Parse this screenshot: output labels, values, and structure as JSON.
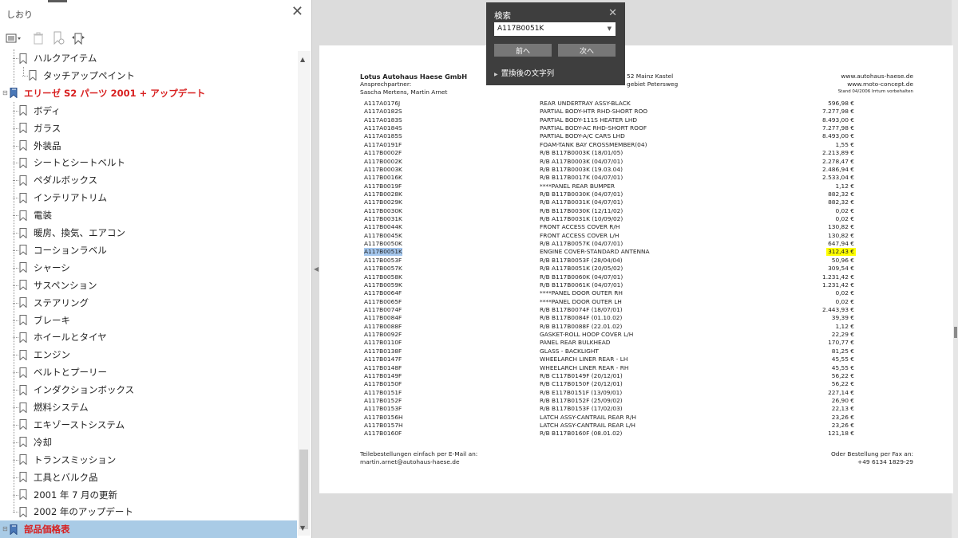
{
  "sidebar": {
    "title": "しおり",
    "toolbar": {
      "options_icon": "list-options-icon",
      "delete_icon": "trash-icon",
      "new_bookmark_icon": "new-bookmark-icon",
      "expand_icon": "expand-bookmark-icon"
    },
    "items": [
      {
        "label": "ハルクアイテム",
        "level": 1
      },
      {
        "label": "タッチアップペイント",
        "level": 2
      },
      {
        "label": "エリーゼ S2 パーツ 2001 + アップデート",
        "level": 0
      },
      {
        "label": "ボディ",
        "level": 1
      },
      {
        "label": "ガラス",
        "level": 1
      },
      {
        "label": "外装品",
        "level": 1
      },
      {
        "label": "シートとシートベルト",
        "level": 1
      },
      {
        "label": "ペダルボックス",
        "level": 1
      },
      {
        "label": "インテリアトリム",
        "level": 1
      },
      {
        "label": "電装",
        "level": 1
      },
      {
        "label": "暖房、換気、エアコン",
        "level": 1
      },
      {
        "label": "コーションラベル",
        "level": 1
      },
      {
        "label": "シャーシ",
        "level": 1
      },
      {
        "label": "サスペンション",
        "level": 1
      },
      {
        "label": "ステアリング",
        "level": 1
      },
      {
        "label": "ブレーキ",
        "level": 1
      },
      {
        "label": "ホイールとタイヤ",
        "level": 1
      },
      {
        "label": "エンジン",
        "level": 1
      },
      {
        "label": "ベルトとプーリー",
        "level": 1
      },
      {
        "label": "インダクションボックス",
        "level": 1
      },
      {
        "label": "燃料システム",
        "level": 1
      },
      {
        "label": "エキゾーストシステム",
        "level": 1
      },
      {
        "label": "冷却",
        "level": 1
      },
      {
        "label": "トランスミッション",
        "level": 1
      },
      {
        "label": "工具とバルク品",
        "level": 1
      },
      {
        "label": "2001 年 7 月の更新",
        "level": 1
      },
      {
        "label": "2002 年のアップデート",
        "level": 1
      },
      {
        "label": "部品価格表",
        "level": 0
      }
    ],
    "selected_index": 27
  },
  "search": {
    "title": "検索",
    "query": "A117B0051K",
    "prev_label": "前へ",
    "next_label": "次へ",
    "replace_label": "置換後の文字列"
  },
  "document": {
    "header": {
      "company": "Lotus Autohaus Haese GmbH",
      "contact_label": "Ansprechpartner:",
      "contacts": "Sascha Mertens, Martin Arnet",
      "address1": "52 Mainz Kastel",
      "address2": "gebiet Petersweg",
      "web1": "www.autohaus-haese.de",
      "web2": "www.moto-concept.de",
      "stand": "Stand 04/2006 Irrtum vorbehalten"
    },
    "rows": [
      {
        "code": "A117A0176J",
        "desc": "REAR UNDERTRAY ASSY-BLACK",
        "price": "596,98 €"
      },
      {
        "code": "A117A0182S",
        "desc": "PARTIAL BODY-HTR RHD-SHORT ROO",
        "price": "7.277,98 €"
      },
      {
        "code": "A117A0183S",
        "desc": "PARTIAL BODY-111S HEATER LHD",
        "price": "8.493,00 €"
      },
      {
        "code": "A117A0184S",
        "desc": "PARTIAL BODY-AC RHD-SHORT ROOF",
        "price": "7.277,98 €"
      },
      {
        "code": "A117A0185S",
        "desc": "PARTIAL BODY-A/C CARS LHD",
        "price": "8.493,00 €"
      },
      {
        "code": "A117A0191F",
        "desc": "FOAM-TANK BAY CROSSMEMBER(04)",
        "price": "1,55 €"
      },
      {
        "code": "A117B0002F",
        "desc": "R/B B117B0003K (18/01/05)",
        "price": "2.213,89 €"
      },
      {
        "code": "A117B0002K",
        "desc": "R/B A117B0003K (04/07/01)",
        "price": "2.278,47 €"
      },
      {
        "code": "A117B0003K",
        "desc": "R/B B117B0003K (19.03.04)",
        "price": "2.486,94 €"
      },
      {
        "code": "A117B0016K",
        "desc": "R/B B117B0017K (04/07/01)",
        "price": "2.533,04 €"
      },
      {
        "code": "A117B0019F",
        "desc": "****PANEL REAR BUMPER",
        "price": "1,12 €"
      },
      {
        "code": "A117B0028K",
        "desc": "R/B B117B0030K (04/07/01)",
        "price": "882,32 €"
      },
      {
        "code": "A117B0029K",
        "desc": "R/B A117B0031K (04/07/01)",
        "price": "882,32 €"
      },
      {
        "code": "A117B0030K",
        "desc": "R/B B117B0030K (12/11/02)",
        "price": "0,02 €"
      },
      {
        "code": "A117B0031K",
        "desc": "R/B A117B0031K (10/09/02)",
        "price": "0,02 €"
      },
      {
        "code": "A117B0044K",
        "desc": "FRONT ACCESS COVER R/H",
        "price": "130,82 €"
      },
      {
        "code": "A117B0045K",
        "desc": "FRONT ACCESS COVER L/H",
        "price": "130,82 €"
      },
      {
        "code": "A117B0050K",
        "desc": "R/B A117B0057K (04/07/01)",
        "price": "647,94 €"
      },
      {
        "code": "A117B0051K",
        "desc": "ENGINE COVER-STANDARD ANTENNA",
        "price": "312,43 €",
        "highlight": true
      },
      {
        "code": "A117B0053F",
        "desc": "R/B B117B0053F (28/04/04)",
        "price": "50,96 €"
      },
      {
        "code": "A117B0057K",
        "desc": "R/B A117B0051K (20/05/02)",
        "price": "309,54 €"
      },
      {
        "code": "A117B0058K",
        "desc": "R/B B117B0060K (04/07/01)",
        "price": "1.231,42 €"
      },
      {
        "code": "A117B0059K",
        "desc": "R/B B117B0061K (04/07/01)",
        "price": "1.231,42 €"
      },
      {
        "code": "A117B0064F",
        "desc": "****PANEL DOOR OUTER RH",
        "price": "0,02 €"
      },
      {
        "code": "A117B0065F",
        "desc": "****PANEL DOOR OUTER LH",
        "price": "0,02 €"
      },
      {
        "code": "A117B0074F",
        "desc": "R/B B117B0074F (18/07/01)",
        "price": "2.443,93 €"
      },
      {
        "code": "A117B0084F",
        "desc": "R/B B117B0084F (01.10.02)",
        "price": "39,39 €"
      },
      {
        "code": "A117B0088F",
        "desc": "R/B B117B0088F (22.01.02)",
        "price": "1,12 €"
      },
      {
        "code": "A117B0092F",
        "desc": "GASKET-ROLL HOOP COVER L/H",
        "price": "22,29 €"
      },
      {
        "code": "A117B0110F",
        "desc": "PANEL REAR BULKHEAD",
        "price": "170,77 €"
      },
      {
        "code": "A117B0138F",
        "desc": "GLASS - BACKLIGHT",
        "price": "81,25 €"
      },
      {
        "code": "A117B0147F",
        "desc": "WHEELARCH LINER REAR - LH",
        "price": "45,55 €"
      },
      {
        "code": "A117B0148F",
        "desc": "WHEELARCH LINER REAR - RH",
        "price": "45,55 €"
      },
      {
        "code": "A117B0149F",
        "desc": "R/B C117B0149F (20/12/01)",
        "price": "56,22 €"
      },
      {
        "code": "A117B0150F",
        "desc": "R/B C117B0150F (20/12/01)",
        "price": "56,22 €"
      },
      {
        "code": "A117B0151F",
        "desc": "R/B E117B0151F (13/09/01)",
        "price": "227,14 €"
      },
      {
        "code": "A117B0152F",
        "desc": "R/B B117B0152F (25/09/02)",
        "price": "26,90 €"
      },
      {
        "code": "A117B0153F",
        "desc": "R/B B117B0153F (17/02/03)",
        "price": "22,13 €"
      },
      {
        "code": "A117B0156H",
        "desc": "LATCH ASSY-CANTRAIL REAR R/H",
        "price": "23,26 €"
      },
      {
        "code": "A117B0157H",
        "desc": "LATCH ASSY-CANTRAIL REAR L/H",
        "price": "23,26 €"
      },
      {
        "code": "A117B0160F",
        "desc": "R/B B117B0160F (08.01.02)",
        "price": "121,18 €"
      }
    ],
    "footer": {
      "left1": "Teilebestellungen einfach per E-Mail an:",
      "left2": "martin.arnet@autohaus-haese.de",
      "right1": "Oder Bestellung per Fax an:",
      "right2": "+49 6134   1829-29"
    }
  }
}
